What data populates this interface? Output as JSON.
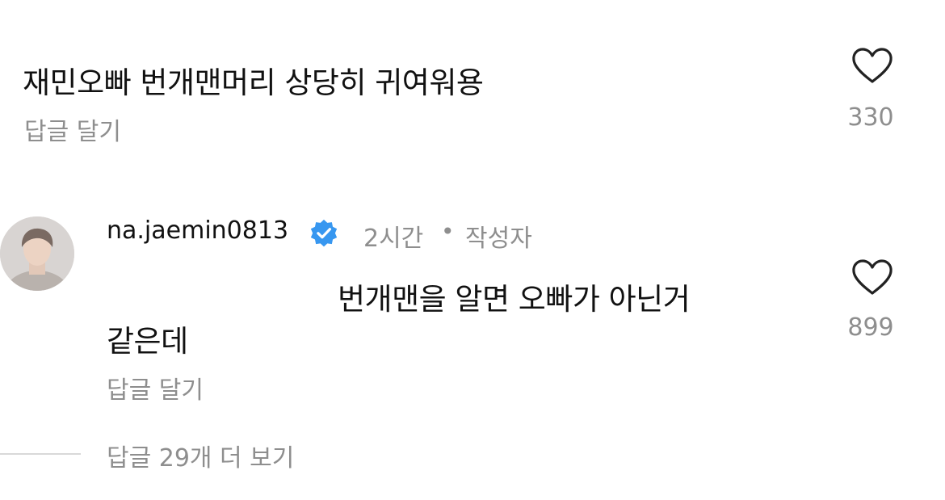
{
  "comment": {
    "text": "재민오빠 번개맨머리 상당히 귀여워용",
    "reply_label": "답글 달기",
    "like_count": "330"
  },
  "reply": {
    "username": "na.jaemin0813",
    "time": "2시간",
    "dot": "•",
    "author_badge": "작성자",
    "text_line1": "번개맨을 알면 오빠가 아닌거",
    "text_line2": "같은데",
    "reply_label": "답글 달기",
    "like_count": "899"
  },
  "view_more": "답글 29개 더 보기",
  "colors": {
    "text": "#111111",
    "secondary": "#8e8e8e",
    "verified": "#3797f0"
  },
  "icons": {
    "like": "heart-icon",
    "verified": "verified-badge-icon"
  }
}
